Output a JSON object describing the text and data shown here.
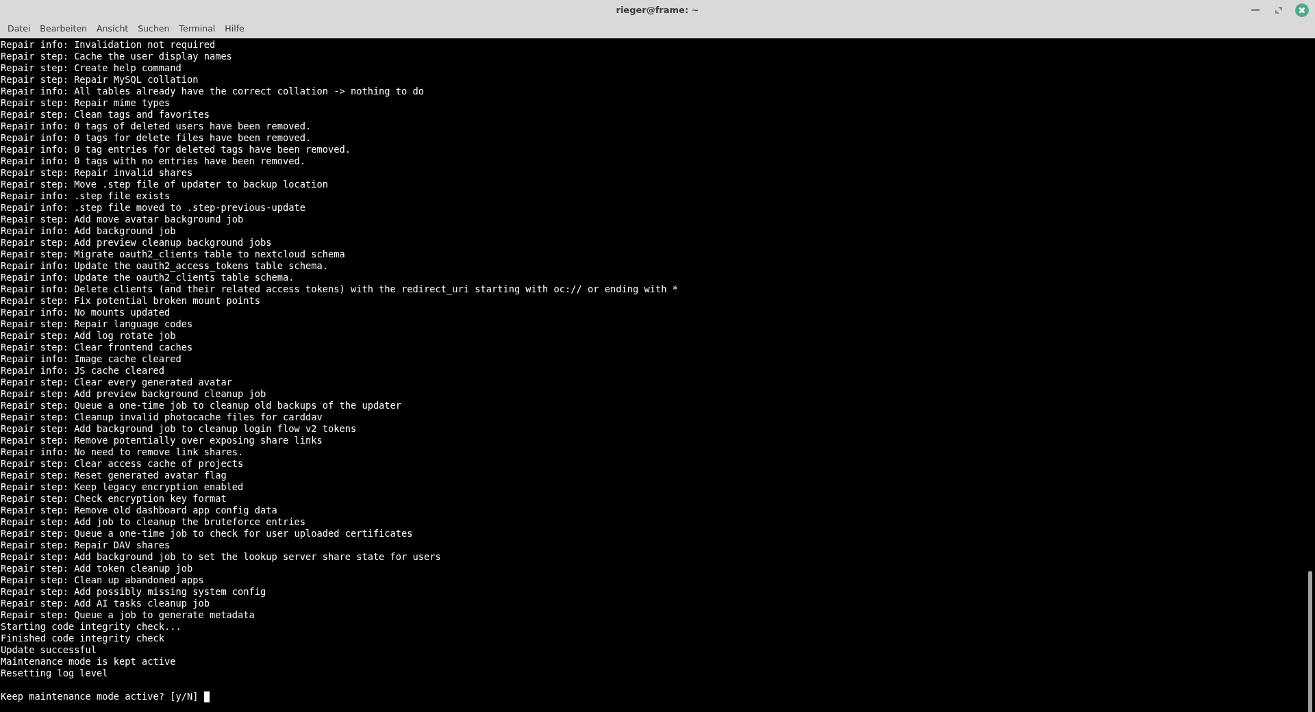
{
  "window": {
    "title": "rieger@frame: ~"
  },
  "menu": [
    "Datei",
    "Bearbeiten",
    "Ansicht",
    "Suchen",
    "Terminal",
    "Hilfe"
  ],
  "terminal": {
    "lines": [
      "Repair info: Invalidation not required",
      "Repair step: Cache the user display names",
      "Repair step: Create help command",
      "Repair step: Repair MySQL collation",
      "Repair info: All tables already have the correct collation -> nothing to do",
      "Repair step: Repair mime types",
      "Repair step: Clean tags and favorites",
      "Repair info: 0 tags of deleted users have been removed.",
      "Repair info: 0 tags for delete files have been removed.",
      "Repair info: 0 tag entries for deleted tags have been removed.",
      "Repair info: 0 tags with no entries have been removed.",
      "Repair step: Repair invalid shares",
      "Repair step: Move .step file of updater to backup location",
      "Repair info: .step file exists",
      "Repair info: .step file moved to .step-previous-update",
      "Repair step: Add move avatar background job",
      "Repair info: Add background job",
      "Repair step: Add preview cleanup background jobs",
      "Repair step: Migrate oauth2_clients table to nextcloud schema",
      "Repair info: Update the oauth2_access_tokens table schema.",
      "Repair info: Update the oauth2_clients table schema.",
      "Repair info: Delete clients (and their related access tokens) with the redirect_uri starting with oc:// or ending with *",
      "Repair step: Fix potential broken mount points",
      "Repair info: No mounts updated",
      "Repair step: Repair language codes",
      "Repair step: Add log rotate job",
      "Repair step: Clear frontend caches",
      "Repair info: Image cache cleared",
      "Repair info: JS cache cleared",
      "Repair step: Clear every generated avatar",
      "Repair step: Add preview background cleanup job",
      "Repair step: Queue a one-time job to cleanup old backups of the updater",
      "Repair step: Cleanup invalid photocache files for carddav",
      "Repair step: Add background job to cleanup login flow v2 tokens",
      "Repair step: Remove potentially over exposing share links",
      "Repair info: No need to remove link shares.",
      "Repair step: Clear access cache of projects",
      "Repair step: Reset generated avatar flag",
      "Repair step: Keep legacy encryption enabled",
      "Repair step: Check encryption key format",
      "Repair step: Remove old dashboard app config data",
      "Repair step: Add job to cleanup the bruteforce entries",
      "Repair step: Queue a one-time job to check for user uploaded certificates",
      "Repair step: Repair DAV shares",
      "Repair step: Add background job to set the lookup server share state for users",
      "Repair step: Add token cleanup job",
      "Repair step: Clean up abandoned apps",
      "Repair step: Add possibly missing system config",
      "Repair step: Add AI tasks cleanup job",
      "Repair step: Queue a job to generate metadata",
      "Starting code integrity check...",
      "Finished code integrity check",
      "Update successful",
      "Maintenance mode is kept active",
      "Resetting log level"
    ],
    "prompt": "Keep maintenance mode active? [y/N]"
  }
}
